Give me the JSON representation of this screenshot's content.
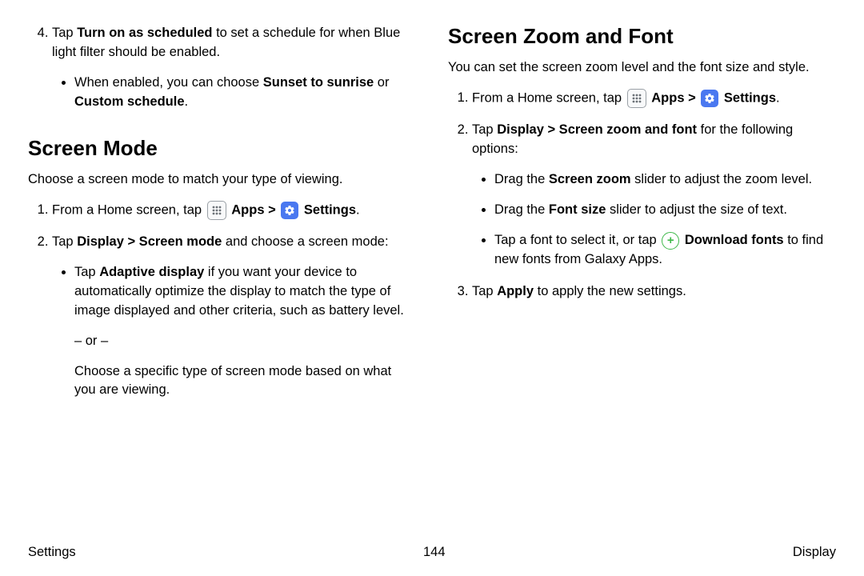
{
  "left": {
    "step4": {
      "num": "4.",
      "pre": "Tap ",
      "bold1": "Turn on as scheduled",
      "post": " to set a schedule for when Blue light filter should be enabled.",
      "sub": {
        "pre": "When enabled, you can choose ",
        "b1": "Sunset to sunrise",
        "mid": " or ",
        "b2": "Custom schedule",
        "end": "."
      }
    },
    "h2": "Screen Mode",
    "intro": "Choose a screen mode to match your type of viewing.",
    "s1": {
      "pre": "From a Home screen, tap ",
      "apps": "Apps",
      "sep": " > ",
      "settings": "Settings",
      "end": "."
    },
    "s2": {
      "pre": "Tap ",
      "b": "Display > Screen mode",
      "post": " and choose a screen mode:",
      "sub1": {
        "pre": "Tap ",
        "b": "Adaptive display",
        "post": " if you want your device to automatically optimize the display to match the type of image displayed and other criteria, such as battery level."
      },
      "or": "– or –",
      "sub2": "Choose a specific type of screen mode based on what you are viewing."
    }
  },
  "right": {
    "h2": "Screen Zoom and Font",
    "intro": "You can set the screen zoom level and the font size and style.",
    "s1": {
      "pre": "From a Home screen, tap ",
      "apps": "Apps",
      "sep": " > ",
      "settings": "Settings",
      "end": "."
    },
    "s2": {
      "pre": "Tap ",
      "b": "Display > Screen zoom and font",
      "post": " for the following options:",
      "b1": {
        "pre": "Drag the ",
        "b": "Screen zoom",
        "post": " slider to adjust the zoom level."
      },
      "b2": {
        "pre": "Drag the ",
        "b": "Font size",
        "post": " slider to adjust the size of text."
      },
      "b3": {
        "pre": "Tap a font to select it, or tap ",
        "b": "Download fonts",
        "post": " to find new fonts from Galaxy Apps."
      }
    },
    "s3": {
      "pre": "Tap ",
      "b": "Apply",
      "post": " to apply the new settings."
    }
  },
  "footer": {
    "left": "Settings",
    "center": "144",
    "right": "Display"
  }
}
